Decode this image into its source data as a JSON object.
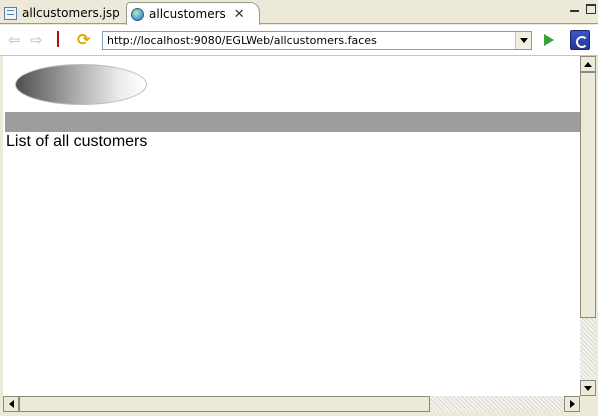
{
  "tabs": [
    {
      "label": "allcustomers.jsp",
      "icon": "jsp-file-icon",
      "active": false
    },
    {
      "label": "allcustomers",
      "icon": "globe-icon",
      "active": true
    }
  ],
  "toolbar": {
    "url": "http://localhost:9080/EGLWeb/allcustomers.faces",
    "buttons": [
      "back-icon",
      "forward-icon",
      "stop-icon",
      "refresh-icon",
      "go-icon",
      "external-browser-icon"
    ]
  },
  "page": {
    "heading": "List of all customers"
  },
  "colors": {
    "banner": "#9d9d9d",
    "stop": "#ee3333",
    "go": "#3aa23a",
    "refresh": "#e3a500"
  }
}
